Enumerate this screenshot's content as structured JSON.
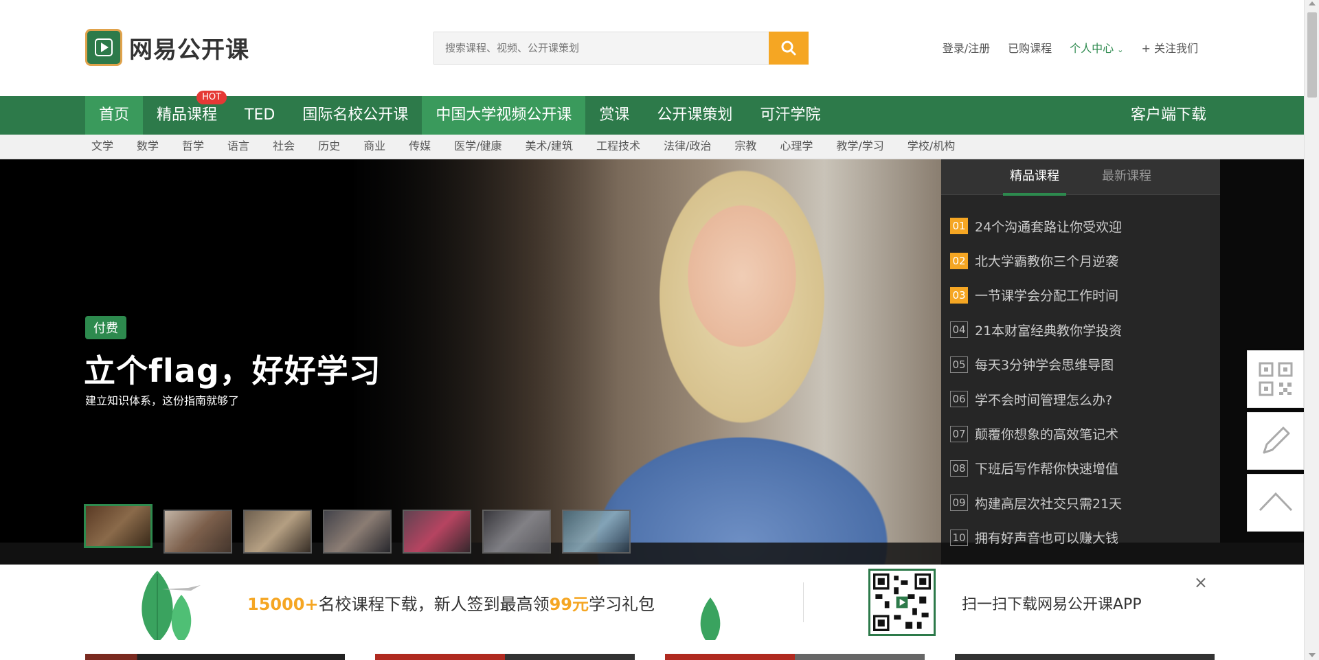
{
  "header": {
    "logo_text": "网易公开课",
    "search_placeholder": "搜索课程、视频、公开课策划",
    "links": {
      "login": "登录/注册",
      "purchased": "已购课程",
      "personal": "个人中心",
      "follow": "关注我们"
    }
  },
  "nav": {
    "items": [
      {
        "label": "首页"
      },
      {
        "label": "精品课程",
        "badge": "HOT"
      },
      {
        "label": "TED"
      },
      {
        "label": "国际名校公开课"
      },
      {
        "label": "中国大学视频公开课"
      },
      {
        "label": "赏课"
      },
      {
        "label": "公开课策划"
      },
      {
        "label": "可汗学院"
      }
    ],
    "right": "客户端下载"
  },
  "subnav": [
    "文学",
    "数学",
    "哲学",
    "语言",
    "社会",
    "历史",
    "商业",
    "传媒",
    "医学/健康",
    "美术/建筑",
    "工程技术",
    "法律/政治",
    "宗教",
    "心理学",
    "教学/学习",
    "学校/机构"
  ],
  "banner": {
    "tag": "付费",
    "title": "立个flag，好好学习",
    "subtitle": "建立知识体系，这份指南就够了"
  },
  "panel": {
    "tabs": [
      "精品课程",
      "最新课程"
    ],
    "courses": [
      {
        "num": "01",
        "title": "24个沟通套路让你受欢迎"
      },
      {
        "num": "02",
        "title": "北大学霸教你三个月逆袭"
      },
      {
        "num": "03",
        "title": "一节课学会分配工作时间"
      },
      {
        "num": "04",
        "title": "21本财富经典教你学投资"
      },
      {
        "num": "05",
        "title": "每天3分钟学会思维导图"
      },
      {
        "num": "06",
        "title": "学不会时间管理怎么办?"
      },
      {
        "num": "07",
        "title": "颠覆你想象的高效笔记术"
      },
      {
        "num": "08",
        "title": "下班后写作帮你快速增值"
      },
      {
        "num": "09",
        "title": "构建高层次社交只需21天"
      },
      {
        "num": "10",
        "title": "拥有好声音也可以赚大钱"
      }
    ]
  },
  "promo": {
    "count": "15000+",
    "text1": "名校课程下载，新人签到最高领",
    "amount": "99元",
    "text2": "学习礼包",
    "scan": "扫一扫下载网易公开课APP",
    "close": "×"
  },
  "colors": {
    "brand_green": "#2d7a4a",
    "accent_orange": "#f5a623"
  }
}
